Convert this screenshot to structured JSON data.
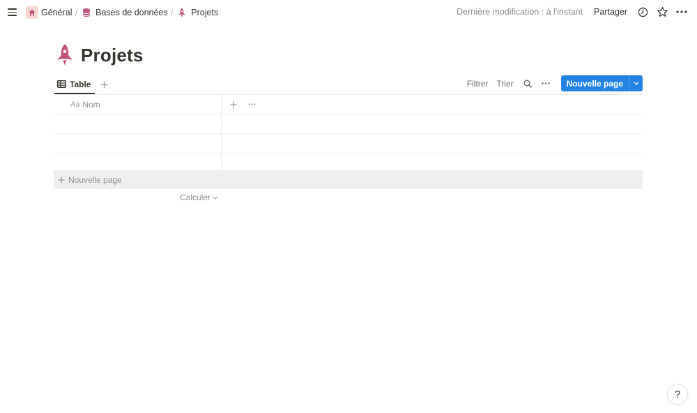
{
  "breadcrumb": {
    "items": [
      {
        "label": "Général",
        "icon": "home-icon"
      },
      {
        "label": "Bases de données",
        "icon": "database-icon"
      },
      {
        "label": "Projets",
        "icon": "rocket-icon"
      }
    ],
    "separator": "/"
  },
  "topbar": {
    "last_edit": "Dernière modification : à l'instant",
    "share": "Partager",
    "icons": [
      "clock-icon",
      "star-icon",
      "more-icon"
    ]
  },
  "page": {
    "title": "Projets",
    "icon": "rocket-icon",
    "accent": "#c1557d"
  },
  "views": {
    "active": "Table",
    "add_icon": "plus-icon"
  },
  "toolbar": {
    "filter": "Filtrer",
    "sort": "Trier",
    "new_page": "Nouvelle page",
    "button_color": "#2383e2"
  },
  "table": {
    "columns": [
      {
        "type_label": "Aa",
        "name": "Nom"
      }
    ],
    "rows": [
      "",
      "",
      ""
    ],
    "new_row": "Nouvelle page",
    "calculate": "Calculer"
  },
  "help": {
    "label": "?"
  }
}
